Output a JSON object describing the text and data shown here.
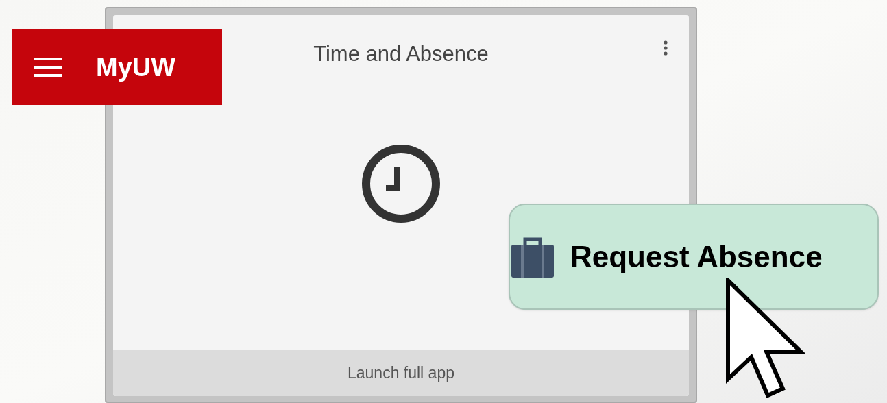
{
  "header": {
    "title": "MyUW"
  },
  "widget": {
    "title": "Time and Absence",
    "footer_link": "Launch full app"
  },
  "callout": {
    "label": "Request Absence"
  }
}
